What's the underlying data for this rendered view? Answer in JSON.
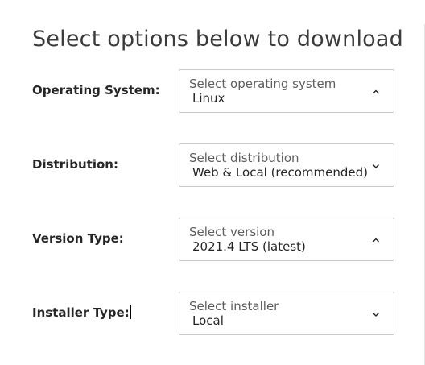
{
  "title": "Select options below to download",
  "rows": [
    {
      "label": "Operating System:",
      "placeholder": "Select operating system",
      "value": "Linux",
      "chevron": "chevron-up-icon"
    },
    {
      "label": "Distribution:",
      "placeholder": "Select distribution",
      "value": "Web & Local (recommended)",
      "chevron": "chevron-down-icon"
    },
    {
      "label": "Version Type:",
      "placeholder": "Select version",
      "value": "2021.4 LTS (latest)",
      "chevron": "chevron-up-icon"
    },
    {
      "label": "Installer Type:",
      "placeholder": "Select installer",
      "value": "Local",
      "chevron": "chevron-down-icon"
    }
  ]
}
